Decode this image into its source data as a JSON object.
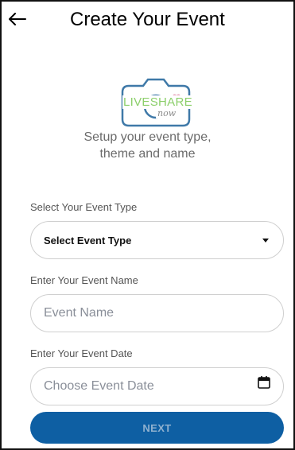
{
  "header": {
    "title": "Create Your Event",
    "back_icon": "arrow-left-icon"
  },
  "logo": {
    "text": "LIVESHARE",
    "sub": "now",
    "icon": "camera-icon",
    "colors": {
      "outline": "#3f79a8",
      "text": "#8ccf6b",
      "heart": "#e8a0b8"
    }
  },
  "intro": {
    "line1": "Setup your event type,",
    "line2": "theme and name"
  },
  "form": {
    "event_type": {
      "label": "Select Your Event Type",
      "selected": "Select Event Type"
    },
    "event_name": {
      "label": "Enter Your Event Name",
      "placeholder": "Event Name"
    },
    "event_date": {
      "label": "Enter Your Event Date",
      "placeholder": "Choose Event Date",
      "icon": "calendar-icon"
    }
  },
  "actions": {
    "next_label": "NEXT"
  },
  "colors": {
    "primary": "#0e5fa3",
    "button_text": "#8fb1cf",
    "placeholder": "#8a8f99",
    "border": "#cfcfcf"
  }
}
